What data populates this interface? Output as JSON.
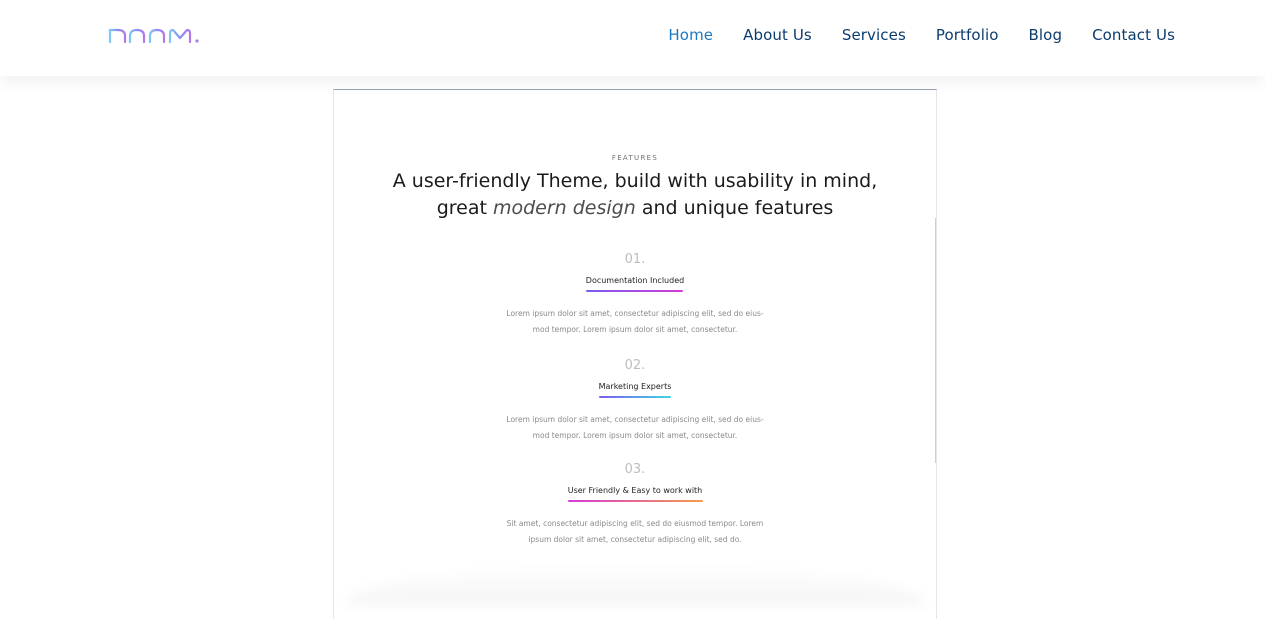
{
  "header": {
    "logo_text": "DOOM.",
    "logo_colors": [
      "#7ec8f5",
      "#8a8ff0",
      "#b07ae8"
    ],
    "nav": [
      {
        "label": "Home",
        "active": true
      },
      {
        "label": "About Us",
        "active": false
      },
      {
        "label": "Services",
        "active": false
      },
      {
        "label": "Portfolio",
        "active": false
      },
      {
        "label": "Blog",
        "active": false
      },
      {
        "label": "Contact Us",
        "active": false
      }
    ]
  },
  "section": {
    "eyebrow": "FEATURES",
    "headline_line1": "A user-friendly Theme, build with usability in mind,",
    "headline_line2_pre": "great ",
    "headline_line2_em": "modern design",
    "headline_line2_post": " and unique features",
    "features": [
      {
        "number": "01.",
        "title": "Documentation Included",
        "underline_colors": [
          "#7b5cf0",
          "#d43bd8"
        ],
        "desc_line1": "Lorem ipsum dolor sit amet, consectetur adipiscing elit, sed do eius-",
        "desc_line2": "mod tempor. Lorem ipsum dolor sit amet, consectetur."
      },
      {
        "number": "02.",
        "title": "Marketing Experts",
        "underline_colors": [
          "#7b5cf0",
          "#3fd7e0"
        ],
        "desc_line1": "Lorem ipsum dolor sit amet, consectetur adipiscing elit, sed do eius-",
        "desc_line2": "mod tempor. Lorem ipsum dolor sit amet, consectetur."
      },
      {
        "number": "03.",
        "title": "User Friendly & Easy to work with",
        "underline_colors": [
          "#d43bd8",
          "#f79a4b"
        ],
        "desc_line1": "Sit amet, consectetur adipiscing elit, sed do eiusmod tempor. Lorem",
        "desc_line2": "ipsum dolor sit amet, consectetur adipiscing elit, sed do."
      }
    ]
  }
}
